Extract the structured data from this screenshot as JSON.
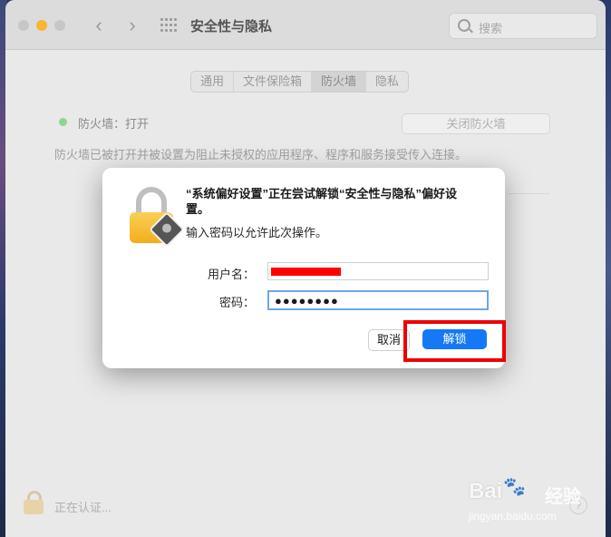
{
  "window": {
    "title": "安全性与隐私"
  },
  "search": {
    "placeholder": "搜索"
  },
  "tabs": [
    {
      "label": "通用"
    },
    {
      "label": "文件保险箱"
    },
    {
      "label": "防火墙"
    },
    {
      "label": "隐私"
    }
  ],
  "firewall": {
    "status": "防火墙：打开",
    "turn_off_button": "关闭防火墙",
    "description": "防火墙已被打开并被设置为阻止未授权的应用程序、程序和服务接受传入连接。"
  },
  "footer": {
    "auth_text": "正在认证...",
    "help": "?"
  },
  "dialog": {
    "title": "“系统偏好设置”正在尝试解锁“安全性与隐私”偏好设置。",
    "message": "输入密码以允许此次操作。",
    "username_label": "用户名：",
    "password_label": "密码：",
    "password_value": "●●●●●●●●",
    "cancel_button": "取消",
    "unlock_button": "解锁"
  },
  "watermark": {
    "brand": "Bai",
    "paw": "🐾",
    "cn": "经验",
    "url": "jingyan.baidu.com"
  },
  "colors": {
    "accent": "#1478f7",
    "highlight": "#ee0000",
    "redaction": "#ff0000"
  }
}
